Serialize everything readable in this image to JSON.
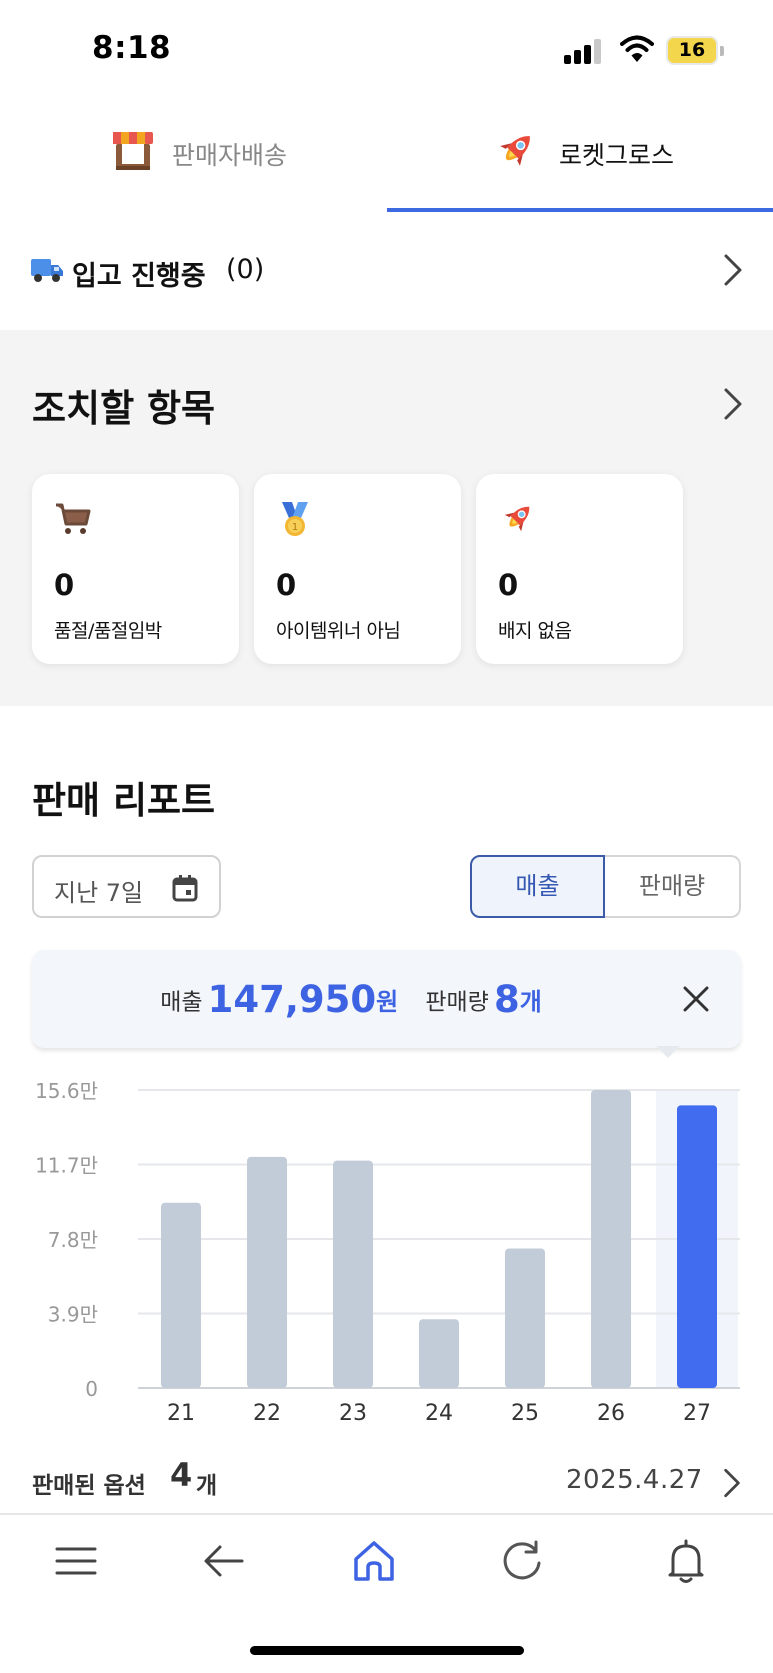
{
  "status_bar": {
    "time": "8:18",
    "battery": "16"
  },
  "tabs": [
    {
      "label": "판매자배송",
      "icon": "storefront-icon",
      "active": false
    },
    {
      "label": "로켓그로스",
      "icon": "rocket-icon",
      "active": true
    }
  ],
  "inbound": {
    "label": "입고 진행중",
    "count": "(0)"
  },
  "action_items": {
    "title": "조치할 항목",
    "cards": [
      {
        "icon": "cart-icon",
        "count": "0",
        "label": "품절/품절임박"
      },
      {
        "icon": "medal-icon",
        "count": "0",
        "label": "아이템위너 아님"
      },
      {
        "icon": "rocket-icon",
        "count": "0",
        "label": "배지 없음"
      }
    ]
  },
  "sales_report": {
    "title": "판매 리포트",
    "period": "지난 7일",
    "toggle": {
      "left": "매출",
      "right": "판매량",
      "selected": "매출"
    },
    "summary": {
      "sales_label": "매출",
      "sales_value": "147,950",
      "sales_unit": "원",
      "qty_label": "판매량",
      "qty_value": "8",
      "qty_unit": "개"
    },
    "sold_options": {
      "label": "판매된 옵션",
      "count": "4",
      "unit": "개",
      "date": "2025.4.27"
    }
  },
  "chart_data": {
    "type": "bar",
    "categories": [
      "21",
      "22",
      "23",
      "24",
      "25",
      "26",
      "27"
    ],
    "values": [
      97000,
      121000,
      119000,
      36000,
      73000,
      156000,
      147950
    ],
    "yticks": [
      "0",
      "3.9만",
      "7.8만",
      "11.7만",
      "15.6만"
    ],
    "ylim": [
      0,
      156000
    ],
    "selected_index": 6,
    "colors": {
      "bar": "#c1ccd8",
      "selected": "#416cf0",
      "grid": "#e5e7eb",
      "highlight": "#f1f4fb"
    }
  },
  "nav": [
    {
      "name": "menu-icon"
    },
    {
      "name": "back-arrow-icon"
    },
    {
      "name": "home-icon",
      "active": true
    },
    {
      "name": "refresh-icon"
    },
    {
      "name": "bell-icon"
    }
  ],
  "colors": {
    "accent": "#3d63e3",
    "tab_underline": "#3d6ae1",
    "section_bg": "#f4f4f4"
  }
}
